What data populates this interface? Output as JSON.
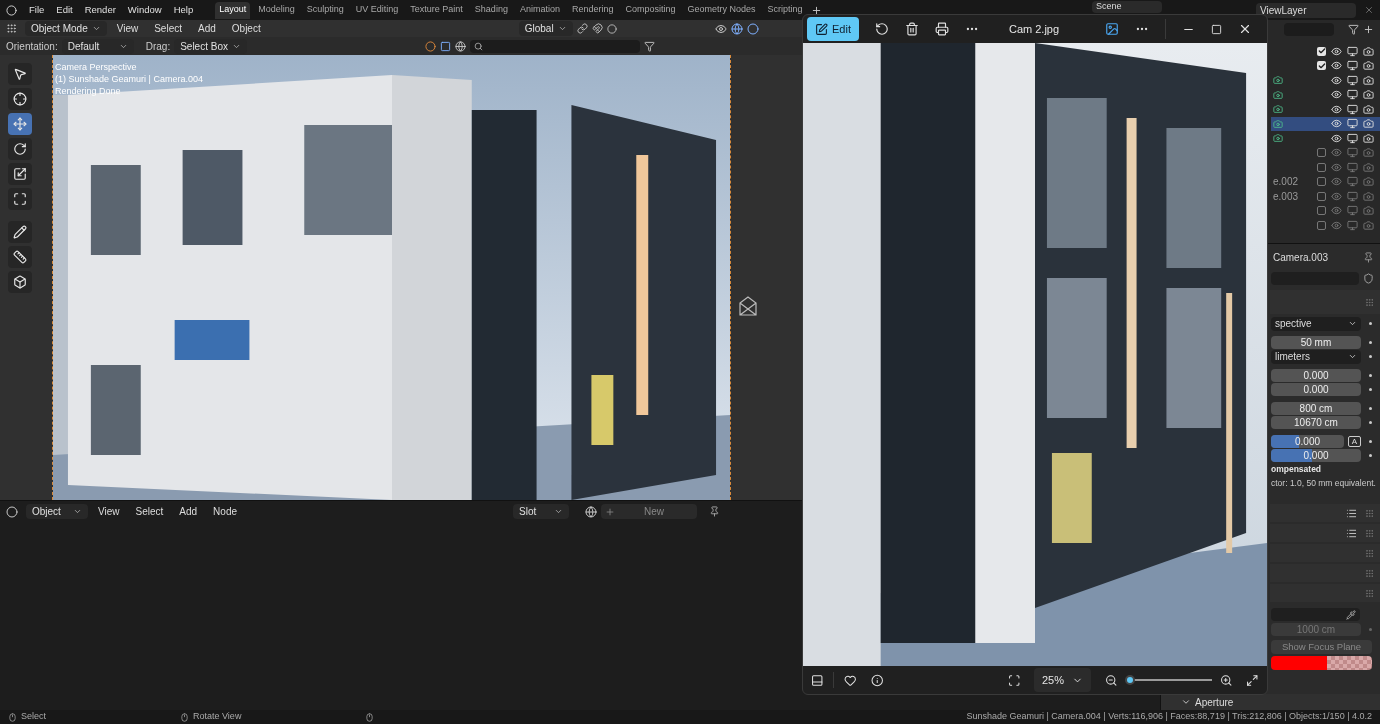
{
  "topbar": {
    "menus": [
      "File",
      "Edit",
      "Render",
      "Window",
      "Help"
    ],
    "workspaces": [
      {
        "label": "Layout",
        "selected": true
      },
      {
        "label": "Modeling",
        "selected": false
      },
      {
        "label": "Sculpting",
        "selected": false
      },
      {
        "label": "UV Editing",
        "selected": false
      },
      {
        "label": "Texture Paint",
        "selected": false
      },
      {
        "label": "Shading",
        "selected": false
      },
      {
        "label": "Animation",
        "selected": false
      },
      {
        "label": "Rendering",
        "selected": false
      },
      {
        "label": "Compositing",
        "selected": false
      },
      {
        "label": "Geometry Nodes",
        "selected": false
      },
      {
        "label": "Scripting",
        "selected": false
      }
    ],
    "scene": "Scene",
    "view_layer": "ViewLayer"
  },
  "viewport": {
    "mode": "Object Mode",
    "menus": [
      "View",
      "Select",
      "Add",
      "Object"
    ],
    "orientation": "Global",
    "tool_settings": {
      "orientation_label": "Orientation:",
      "orientation": "Default",
      "drag_label": "Drag:",
      "drag": "Select Box"
    },
    "overlay_text": [
      "Camera Perspective",
      "(1) Sunshade Geamuri | Camera.004",
      "Rendering Done"
    ]
  },
  "shader_editor": {
    "mode": "Object",
    "menus": [
      "View",
      "Select",
      "Add",
      "Node"
    ],
    "slot": "Slot",
    "new_button": "New"
  },
  "outliner": {
    "rows": [
      {
        "kind": "collection",
        "checked": true,
        "selected": false
      },
      {
        "kind": "collection",
        "checked": true,
        "selected": false
      },
      {
        "kind": "camera",
        "selected": false
      },
      {
        "kind": "camera",
        "selected": false
      },
      {
        "kind": "camera",
        "selected": false
      },
      {
        "kind": "camera",
        "selected": true
      },
      {
        "kind": "camera",
        "selected": false
      },
      {
        "kind": "collection",
        "checked": false,
        "selected": false
      },
      {
        "kind": "collection",
        "checked": false,
        "selected": false
      },
      {
        "kind": "collection",
        "checked": false,
        "selected": false,
        "name": "e.002"
      },
      {
        "kind": "collection",
        "checked": false,
        "selected": false,
        "name": "e.003"
      },
      {
        "kind": "collection",
        "checked": false,
        "selected": false
      },
      {
        "kind": "collection",
        "checked": false,
        "selected": false
      }
    ]
  },
  "properties": {
    "object_name": "Camera.003",
    "rows": [
      {
        "kind": "dropdown",
        "value": "spective"
      },
      {
        "kind": "field",
        "value": "50 mm"
      },
      {
        "kind": "dropdown",
        "value": "limeters"
      },
      {
        "kind": "field",
        "value": "0.000"
      },
      {
        "kind": "field",
        "value": "0.000"
      },
      {
        "kind": "field",
        "value": "800 cm"
      },
      {
        "kind": "field",
        "value": "10670 cm"
      },
      {
        "kind": "slider",
        "value": "0.000",
        "level": 0.38,
        "badge": "A"
      },
      {
        "kind": "slider",
        "value": "0.000",
        "level": 0.45
      },
      {
        "kind": "note",
        "value": "ompensated"
      },
      {
        "kind": "note",
        "value": "ctor: 1.0, 50 mm equivalent."
      }
    ],
    "focus_distance": "1000 cm",
    "focus_button": "Show Focus Plane",
    "focus_plane": {
      "color": "#ff0000"
    },
    "aperture": "Aperture"
  },
  "photo_viewer": {
    "edit_button": "Edit",
    "title": "Cam 2.jpg",
    "zoom": "25%",
    "zoom_slider": {
      "level": 0.03
    }
  },
  "status_bar": {
    "hints": [
      "Select",
      "Rotate View"
    ],
    "stats": "Sunshade Geamuri | Camera.004 | Verts:116,906 | Faces:88,719 | Tris:212,806 | Objects:1/150 | 4.0.2"
  }
}
